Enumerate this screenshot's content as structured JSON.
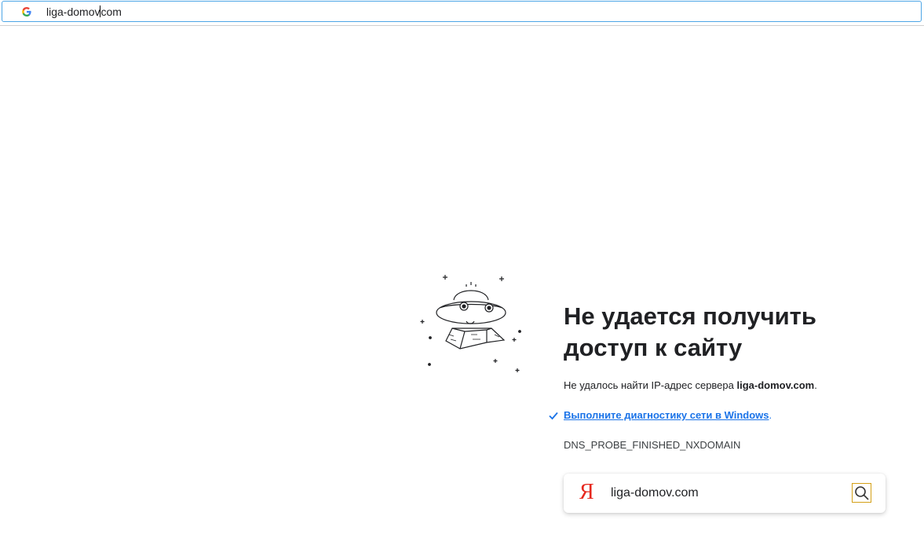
{
  "address_bar": {
    "url_before_caret": "liga-domov",
    "url_after_caret": "com",
    "favicon": "google-g-icon"
  },
  "error": {
    "title": "Не удается получить доступ к сайту",
    "message_prefix": "Не удалось найти IP-адрес сервера ",
    "message_domain": "liga-domov.com",
    "message_suffix": ".",
    "diagnostics_link": "Выполните диагностику сети в Windows",
    "diagnostics_suffix": ".",
    "error_code": "DNS_PROBE_FINISHED_NXDOMAIN"
  },
  "search": {
    "engine_icon_text": "Я",
    "value": "liga-domov.com",
    "button_icon": "search-icon"
  },
  "colors": {
    "accent": "#1a73e8",
    "address_border": "#4ea6e6",
    "yandex_red": "#e6281e",
    "search_button_border": "#d4a017"
  }
}
